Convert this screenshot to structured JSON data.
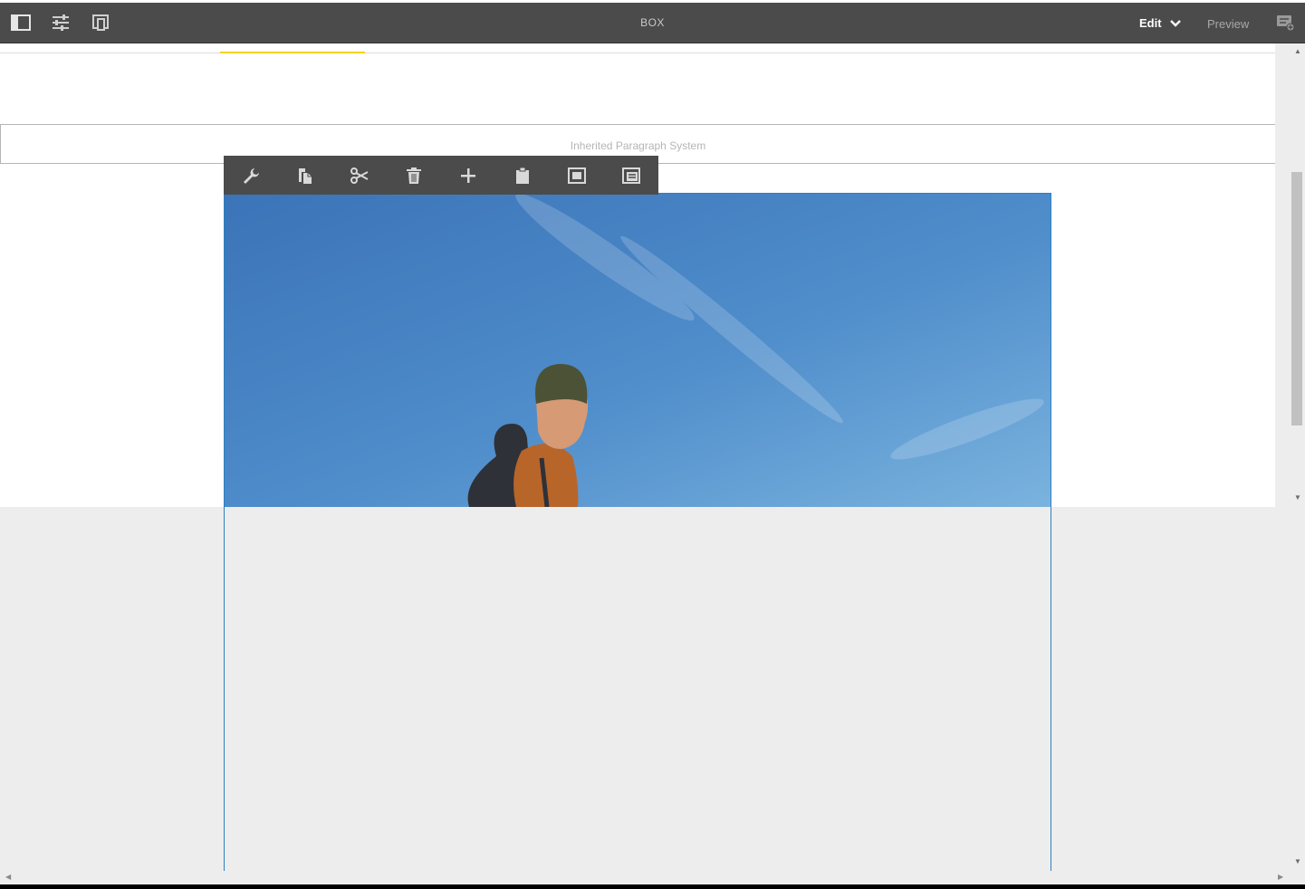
{
  "app": {
    "title": "BOX",
    "mode_label": "Edit",
    "preview_label": "Preview"
  },
  "topbar_icons": [
    "side-panel-icon",
    "page-properties-icon",
    "emulator-icon",
    "annotations-icon"
  ],
  "parsys": {
    "label": "Inherited Paragraph System"
  },
  "component_toolbar": {
    "tools": [
      "configure-icon",
      "copy-icon",
      "cut-icon",
      "delete-icon",
      "insert-icon",
      "paste-icon",
      "group-icon",
      "parent-icon"
    ]
  },
  "image": {
    "description_icon": "image-icon"
  },
  "colors": {
    "topbar_bg": "#4b4b4b",
    "selection_border": "#2d7fc1",
    "highlight_yellow": "#f4d21d",
    "canvas_bg": "#ededed"
  }
}
